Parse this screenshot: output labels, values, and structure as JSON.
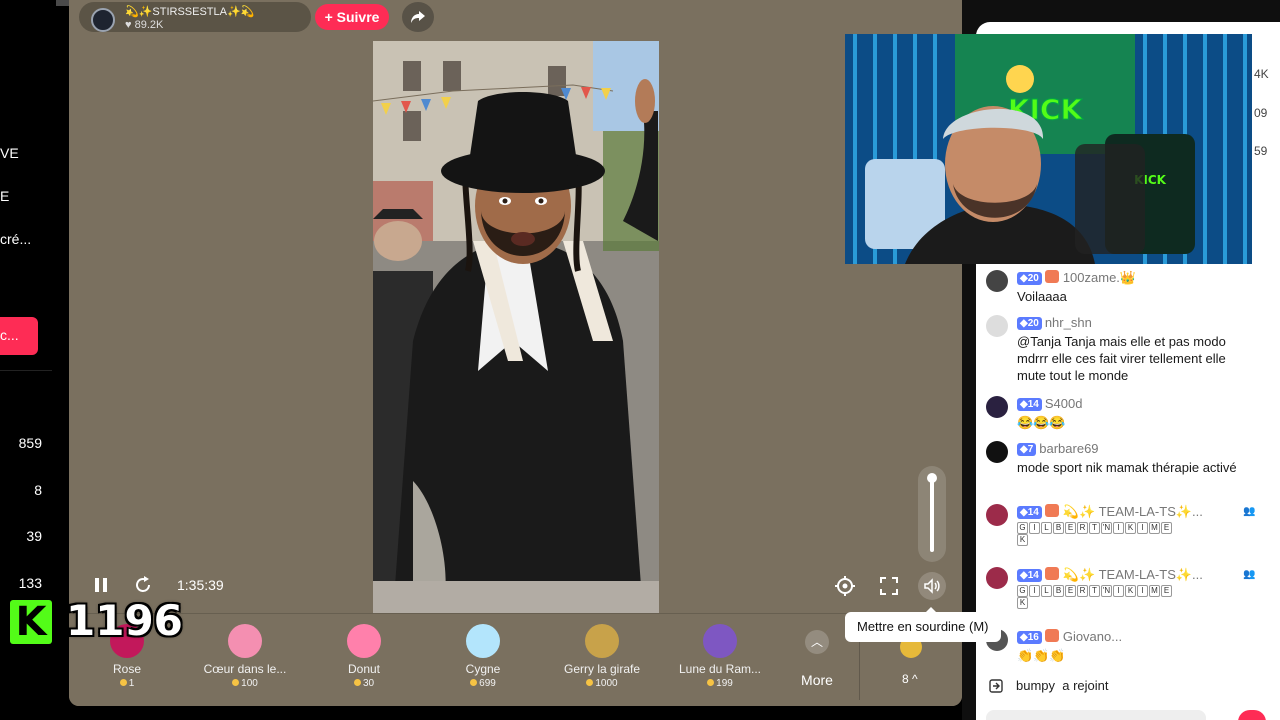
{
  "sidebar": {
    "texts": [
      "VE",
      "E",
      "cré..."
    ],
    "red_button": "c...",
    "numbers": [
      "859",
      "8",
      "39",
      "133"
    ]
  },
  "host": {
    "name": "💫✨STIRSSESTLA✨💫",
    "likes": "89.2K",
    "follow_label": "+ Suivre"
  },
  "player": {
    "time": "1:35:39",
    "tooltip": "Mettre en sourdine (M)"
  },
  "overlay": {
    "k_letter": "K",
    "count": "1196"
  },
  "gifts": [
    {
      "name": "Rose",
      "price": "1",
      "color": "#c2185b"
    },
    {
      "name": "Cœur dans le...",
      "price": "100",
      "color": "#f48fb1"
    },
    {
      "name": "Donut",
      "price": "30",
      "color": "#ff80ab"
    },
    {
      "name": "Cygne",
      "price": "699",
      "color": "#b3e5fc"
    },
    {
      "name": "Gerry la girafe",
      "price": "1000",
      "color": "#c8a24a"
    },
    {
      "name": "Lune du Ram...",
      "price": "199",
      "color": "#7e57c2"
    }
  ],
  "gift_bar": {
    "more_label": "More",
    "rank_label": "8 ^"
  },
  "side_numbers": [
    "4K",
    "09",
    "59"
  ],
  "chat": {
    "messages": [
      {
        "level": "20",
        "user": "100zame.👑",
        "text": "Voilaaaa",
        "heart": true
      },
      {
        "level": "20",
        "user": "nhr_shn",
        "text": "@Tanja Tanja mais elle et pas modo mdrrr elle ces fait virer tellement elle mute tout le monde",
        "heart": false
      },
      {
        "level": "14",
        "user": "S400d",
        "text": "😂😂😂",
        "heart": false
      },
      {
        "level": "7",
        "user": "barbare69",
        "text": "mode sport nik mamak thérapie activé",
        "heart": false
      },
      {
        "level": "14",
        "user": "💫✨ TEAM-LA-TS✨...",
        "letters": [
          "G",
          "I",
          "L",
          "B",
          "E",
          "R",
          "T",
          "'N",
          "I",
          "K",
          "I",
          "M",
          "E",
          "K"
        ],
        "heart": true
      },
      {
        "level": "14",
        "user": "💫✨ TEAM-LA-TS✨...",
        "letters": [
          "G",
          "I",
          "L",
          "B",
          "E",
          "R",
          "T",
          "'N",
          "I",
          "K",
          "I",
          "M",
          "E",
          "K"
        ],
        "heart": true
      },
      {
        "level": "16",
        "user": "Giovano...",
        "text": "👏👏👏",
        "heart": true
      }
    ],
    "joined_user": "bumpy",
    "joined_text": "a rejoint"
  },
  "colors": {
    "accent": "#fe2c55",
    "kick_green": "#53fc18",
    "player_bg": "#7a705f",
    "badge_blue": "#5b7bff"
  },
  "icons": {
    "pause": "pause-icon",
    "replay": "replay-icon",
    "settings": "gear-icon",
    "fullscreen": "fullscreen-icon",
    "volume": "volume-icon",
    "share": "share-icon"
  }
}
